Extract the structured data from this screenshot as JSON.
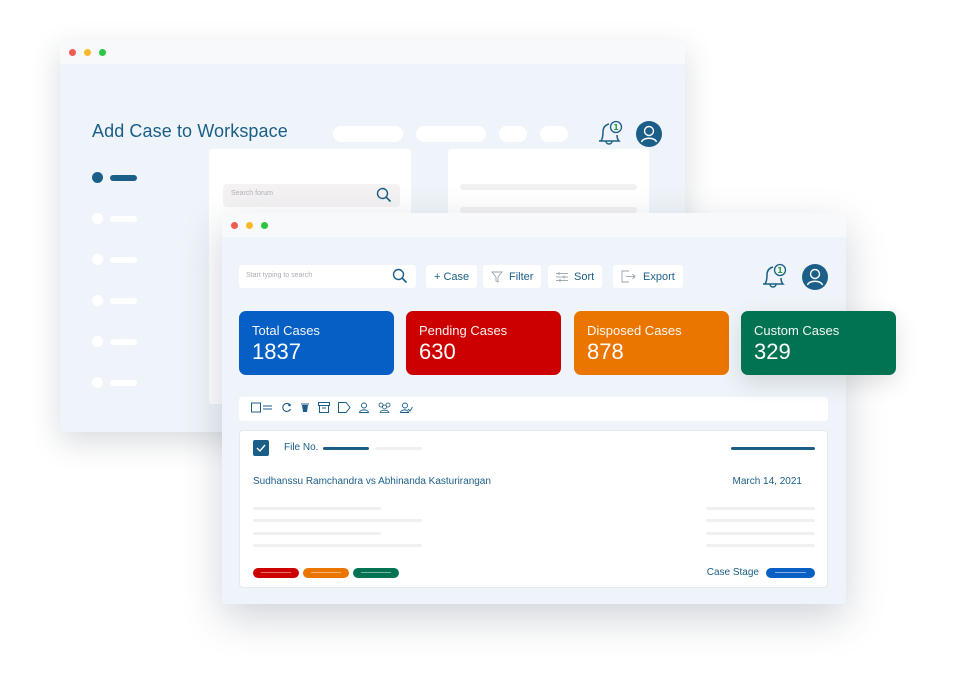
{
  "back_window": {
    "title": "Add Case to Workspace",
    "search_placeholder": "Search forum",
    "notification_count": "1",
    "nav_items": [
      {
        "state": "active"
      },
      {
        "state": "inactive"
      },
      {
        "state": "inactive"
      },
      {
        "state": "inactive"
      },
      {
        "state": "inactive"
      },
      {
        "state": "inactive"
      }
    ]
  },
  "front_window": {
    "search_placeholder": "Start typing to search",
    "toolbar": {
      "add_case_label": "+ Case",
      "filter_label": "Filter",
      "sort_label": "Sort",
      "export_label": "Export"
    },
    "notification_count": "1",
    "stats": [
      {
        "label": "Total Cases",
        "value": "1837",
        "color": "#065fc4"
      },
      {
        "label": "Pending Cases",
        "value": "630",
        "color": "#cc0000"
      },
      {
        "label": "Disposed Cases",
        "value": "878",
        "color": "#ea7600"
      },
      {
        "label": "Custom Cases",
        "value": "329",
        "color": "#027352"
      }
    ],
    "action_icons": [
      "select-all-icon",
      "refresh-icon",
      "delete-icon",
      "archive-icon",
      "label-icon",
      "user-icon",
      "group-icon",
      "assign-user-icon"
    ],
    "case": {
      "file_label": "File No.",
      "title": "Sudhanssu Ramchandra vs Abhinanda Kasturirangan",
      "date": "March 14, 2021",
      "stage_label": "Case Stage",
      "tags": [
        {
          "color": "#cc0000"
        },
        {
          "color": "#ea7600"
        },
        {
          "color": "#027352"
        }
      ]
    }
  },
  "colors": {
    "primary": "#1b5e88",
    "background": "#eef4f9"
  }
}
